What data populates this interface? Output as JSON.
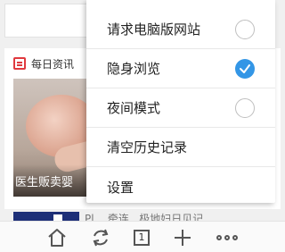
{
  "background": {
    "news_section_title": "每日资讯",
    "news_image_caption": "医生贩卖婴",
    "second_item_text": "Pl...  牵连...极地妇日见记"
  },
  "menu": {
    "items": [
      {
        "label": "请求电脑版网站",
        "checked": false,
        "has_toggle": true
      },
      {
        "label": "隐身浏览",
        "checked": true,
        "has_toggle": true
      },
      {
        "label": "夜间模式",
        "checked": false,
        "has_toggle": true
      },
      {
        "label": "清空历史记录",
        "has_toggle": false
      },
      {
        "label": "设置",
        "has_toggle": false
      }
    ]
  },
  "toolbar": {
    "home_icon": "home-icon",
    "refresh_icon": "refresh-icon",
    "tab_count": "1",
    "add_icon": "plus-icon",
    "more_icon": "more-icon"
  },
  "colors": {
    "accent": "#3396e6",
    "news_icon": "#e0393e"
  }
}
